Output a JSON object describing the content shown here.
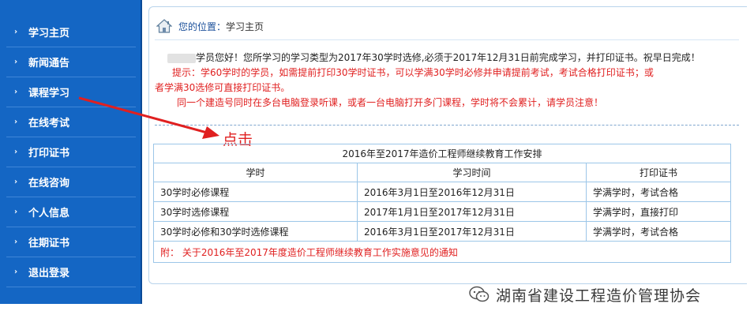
{
  "sidebar": {
    "bullet_glyph": "›",
    "items": [
      {
        "label": "学习主页"
      },
      {
        "label": "新闻通告"
      },
      {
        "label": "课程学习"
      },
      {
        "label": "在线考试"
      },
      {
        "label": "打印证书"
      },
      {
        "label": "在线咨询"
      },
      {
        "label": "个人信息"
      },
      {
        "label": "往期证书"
      },
      {
        "label": "退出登录"
      }
    ]
  },
  "breadcrumb": {
    "prefix": "您的位置：",
    "current": "学习主页"
  },
  "notice": {
    "greeting": "学员您好！您所学习的学习类型为2017年30学时选修,必须于2017年12月31日前完成学习，并打印证书。祝早日完成！",
    "tip_line1": "提示：学60学时的学员，如需提前打印30学时证书，可以学满30学时必修并申请提前考试，考试合格打印证书；或",
    "tip_line2": "者学满30选修可直接打印证书。",
    "tip_line3": "同一个建造号同时在多台电脑登录听课，或者一台电脑打开多门课程，学时将不会累计，请学员注意！"
  },
  "annotation": {
    "click_text": "点击"
  },
  "schedule": {
    "title": "2016年至2017年造价工程师继续教育工作安排",
    "headers": [
      "学时",
      "学习时间",
      "打印证书"
    ],
    "rows": [
      [
        "30学时必修课程",
        "2016年3月1日至2016年12月31日",
        "学满学时，考试合格"
      ],
      [
        "30学时选修课程",
        "2017年1月1日至2017年12月31日",
        "学满学时，直接打印"
      ],
      [
        "30学时必修和30学时选修课程",
        "2016年3月1日至2017年12月31日",
        "学满学时，考试合格"
      ]
    ],
    "attachment": "附： 关于2016年至2017年度造价工程师继续教育工作实施意见的通知"
  },
  "watermark": {
    "text": "湖南省建设工程造价管理协会"
  },
  "colors": {
    "sidebar_bg": "#1466c4",
    "accent_red": "#e02020",
    "table_border": "#9cc6e8"
  }
}
